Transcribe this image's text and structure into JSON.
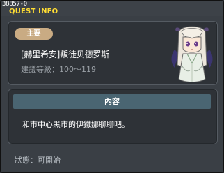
{
  "window": {
    "quest_id": "38857-0",
    "title": "QUEST INFO"
  },
  "quest": {
    "type_tag": "主要",
    "name": "[赫里希安]叛徒贝德罗斯",
    "recommended_level": "建議等級：100～119",
    "npc_icon": "npc-portrait-icon"
  },
  "content": {
    "header": "內容",
    "description": "和市中心黑市的伊鐵娜聊聊吧。"
  },
  "status": {
    "label": "狀態：可開始"
  },
  "colors": {
    "title": "#ffdd33",
    "tag_bg": "#c9ab83",
    "header_bg": "#4a6572"
  }
}
